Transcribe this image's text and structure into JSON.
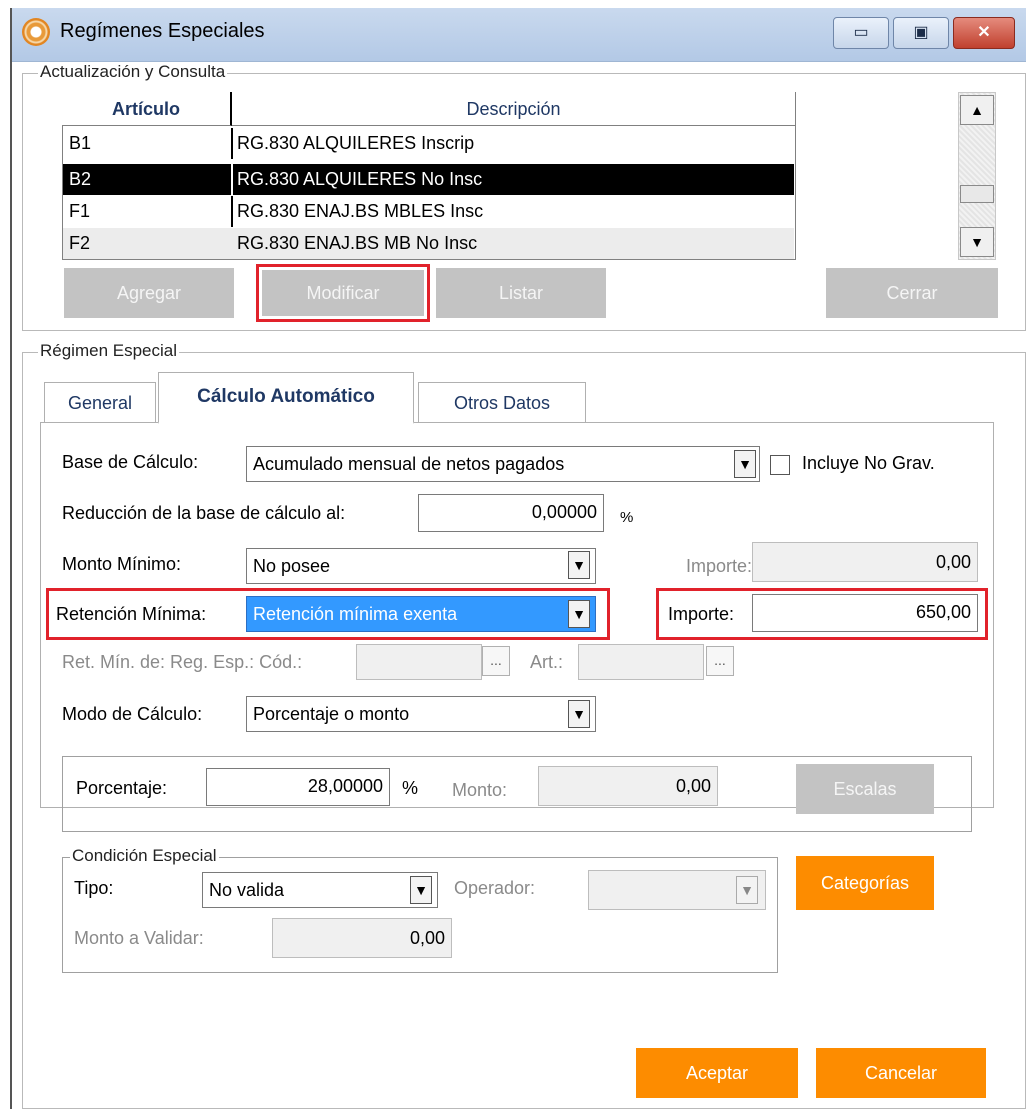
{
  "window": {
    "title": "Regímenes Especiales",
    "minimize": "▭",
    "maximize": "▣",
    "close": "✕"
  },
  "section1": {
    "legend": "Actualización y Consulta",
    "grid": {
      "columns": [
        "Artículo",
        "Descripción"
      ],
      "rows": [
        {
          "articulo": "B1",
          "descripcion": "RG.830 ALQUILERES Inscrip"
        },
        {
          "articulo": "B2",
          "descripcion": "RG.830 ALQUILERES No Insc"
        },
        {
          "articulo": "F1",
          "descripcion": "RG.830 ENAJ.BS MBLES Insc"
        },
        {
          "articulo": "F2",
          "descripcion": "RG.830 ENAJ.BS MB No Insc"
        }
      ]
    },
    "buttons": {
      "agregar": "Agregar",
      "modificar": "Modificar",
      "listar": "Listar",
      "cerrar": "Cerrar"
    }
  },
  "section2": {
    "legend": "Régimen Especial",
    "tabs": {
      "general": "General",
      "calculo": "Cálculo Automático",
      "otros": "Otros Datos"
    },
    "form": {
      "base_label": "Base de Cálculo:",
      "base_value": "Acumulado mensual de netos pagados",
      "incluye_label": "Incluye No Grav.",
      "reduccion_label": "Reducción de la base de cálculo al:",
      "reduccion_value": "0,00000",
      "percent": "%",
      "monto_min_label": "Monto Mínimo:",
      "monto_min_value": "No posee",
      "importe_label": "Importe:",
      "importe_min_value": "0,00",
      "ret_min_label": "Retención Mínima:",
      "ret_min_value": "Retención mínima exenta",
      "importe_ret_value": "650,00",
      "ret_reg_label": "Ret. Mín. de: Reg. Esp.: Cód.:",
      "art_label": "Art.:",
      "ellipsis": "...",
      "modo_label": "Modo de Cálculo:",
      "modo_value": "Porcentaje o monto",
      "porcentaje_label": "Porcentaje:",
      "porcentaje_value": "28,00000",
      "monto_label": "Monto:",
      "monto_value": "0,00",
      "escalas": "Escalas",
      "condicion_legend": "Condición Especial",
      "tipo_label": "Tipo:",
      "tipo_value": "No valida",
      "operador_label": "Operador:",
      "monto_validar_label": "Monto a Validar:",
      "monto_validar_value": "0,00",
      "categorias": "Categorías"
    },
    "buttons": {
      "aceptar": "Aceptar",
      "cancelar": "Cancelar"
    }
  },
  "colors": {
    "accent_orange": "#fd8c00",
    "highlight_red": "#e1222b",
    "selection_blue": "#3399ff",
    "disabled_gray": "#c3c3c3"
  }
}
